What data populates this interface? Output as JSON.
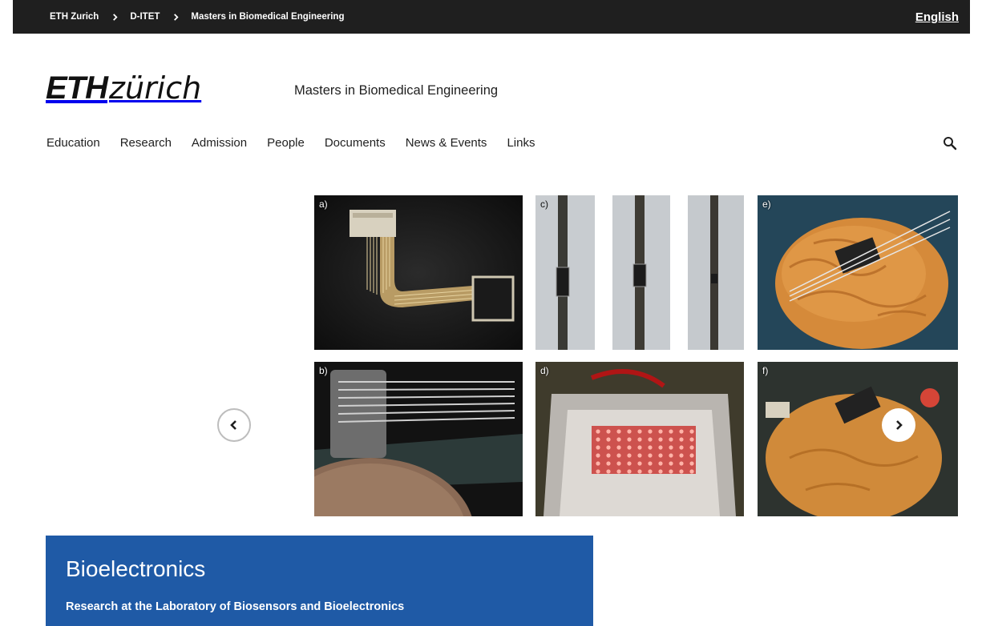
{
  "breadcrumbs": [
    {
      "label": "ETH Zurich"
    },
    {
      "label": "D-ITET"
    },
    {
      "label": "Masters in Biomedical Engineering"
    }
  ],
  "language": "English",
  "logo": {
    "eth": "ETH",
    "zurich": "zürich"
  },
  "site_title": "Masters in Biomedical Engineering",
  "nav": [
    {
      "label": "Education"
    },
    {
      "label": "Research"
    },
    {
      "label": "Admission"
    },
    {
      "label": "People"
    },
    {
      "label": "Documents"
    },
    {
      "label": "News & Events"
    },
    {
      "label": "Links"
    }
  ],
  "search_icon": "search-icon",
  "gallery": {
    "panels": [
      "a)",
      "b)",
      "c)",
      "d)",
      "e)",
      "f)"
    ]
  },
  "carousel": {
    "prev_icon": "chevron-left-icon",
    "next_icon": "chevron-right-icon"
  },
  "hero": {
    "title": "Bioelectronics",
    "subtitle": "Research at the Laboratory of Biosensors and Bioelectronics"
  },
  "colors": {
    "topbar": "#1f1f1f",
    "hero_panel": "#1f5aa6"
  }
}
